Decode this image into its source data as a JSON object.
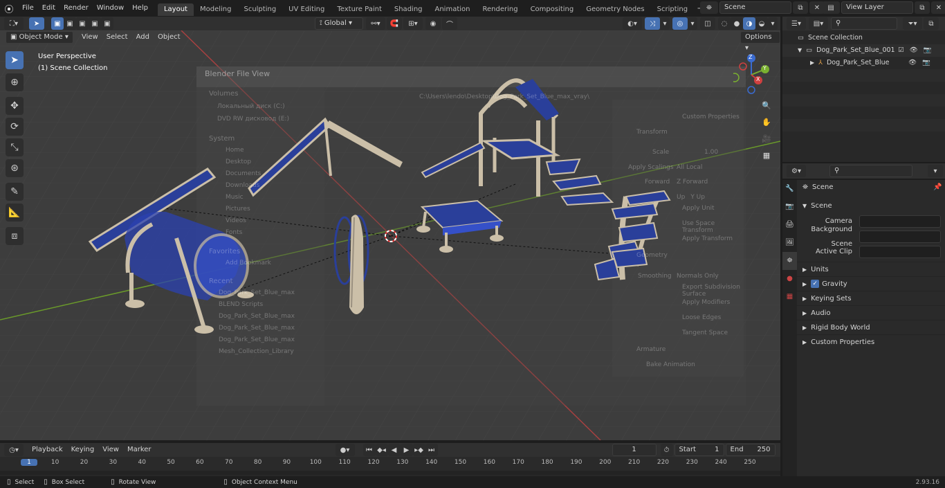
{
  "top_menu": [
    "File",
    "Edit",
    "Render",
    "Window",
    "Help"
  ],
  "workspace_tabs": [
    "Layout",
    "Modeling",
    "Sculpting",
    "UV Editing",
    "Texture Paint",
    "Shading",
    "Animation",
    "Rendering",
    "Compositing",
    "Geometry Nodes",
    "Scripting"
  ],
  "active_tab": "Layout",
  "scene_name": "Scene",
  "view_layer": "View Layer",
  "viewport_header": {
    "mode": "Object Mode",
    "menus": [
      "View",
      "Select",
      "Add",
      "Object"
    ],
    "orientation": "Global",
    "options": "Options"
  },
  "viewport": {
    "perspective": "User Perspective",
    "collection": "(1) Scene Collection",
    "gizmo_axes": [
      "Z",
      "Y",
      "X"
    ]
  },
  "file_view": {
    "title": "Blender File View",
    "path": "C:\\Users\\lendo\\Desktop\\Dog_Park_Set_Blue_max_vray\\",
    "sections": [
      "Volumes",
      "System",
      "Favorites",
      "Recent"
    ],
    "volumes": [
      "Локальный диск (C:)",
      "DVD RW дисковод (E:)"
    ],
    "system": [
      "Home",
      "Desktop",
      "Documents",
      "Downloads",
      "Music",
      "Pictures",
      "Videos",
      "Fonts"
    ],
    "favorites": [
      "Add Bookmark"
    ],
    "recent": [
      "Dog_Park_Set_Blue_max",
      "BLEND Scripts",
      "Dog_Park_Set_Blue_max",
      "Dog_Park_Set_Blue_max",
      "Dog_Park_Set_Blue_max",
      "Mesh_Collection_Library"
    ],
    "export_settings": {
      "custom_properties": "Custom Properties",
      "transform_section": "Transform",
      "scale_label": "Scale",
      "scale_value": "1.00",
      "apply_scalings_label": "Apply Scalings",
      "apply_scalings_value": "All Local",
      "forward_label": "Forward",
      "forward_value": "Z Forward",
      "up_label": "Up",
      "up_value": "Y Up",
      "apply_unit": "Apply Unit",
      "use_space_transform": "Use Space Transform",
      "apply_transform": "Apply Transform",
      "geometry_section": "Geometry",
      "smoothing_label": "Smoothing",
      "smoothing_value": "Normals Only",
      "export_subdivision": "Export Subdivision Surface",
      "apply_modifiers": "Apply Modifiers",
      "loose_edges": "Loose Edges",
      "tangent_space": "Tangent Space",
      "armature_section": "Armature",
      "bake_animation": "Bake Animation"
    }
  },
  "outliner": {
    "root": "Scene Collection",
    "items": [
      {
        "label": "Dog_Park_Set_Blue_001",
        "level": 1
      },
      {
        "label": "Dog_Park_Set_Blue",
        "level": 2
      }
    ]
  },
  "properties": {
    "header": "Scene",
    "section": "Scene",
    "fields": [
      {
        "label": "Camera",
        "value": ""
      },
      {
        "label": "Background Scene",
        "value": ""
      },
      {
        "label": "Active Clip",
        "value": ""
      }
    ],
    "panels": [
      "Units",
      "Gravity",
      "Keying Sets",
      "Audio",
      "Rigid Body World",
      "Custom Properties"
    ],
    "gravity_checked": true
  },
  "timeline": {
    "menus": [
      "Playback",
      "Keying",
      "View",
      "Marker"
    ],
    "current_frame": "1",
    "start_label": "Start",
    "start": "1",
    "end_label": "End",
    "end": "250",
    "ticks": [
      "1",
      "10",
      "20",
      "30",
      "40",
      "50",
      "60",
      "70",
      "80",
      "90",
      "100",
      "110",
      "120",
      "130",
      "140",
      "150",
      "160",
      "170",
      "180",
      "190",
      "200",
      "210",
      "220",
      "230",
      "240",
      "250"
    ]
  },
  "statusbar": {
    "items": [
      "Select",
      "Box Select",
      "Rotate View",
      "Object Context Menu"
    ],
    "version": "2.93.16"
  },
  "colors": {
    "accent": "#4772b3",
    "equipment_blue": "#2a3f9a",
    "equipment_frame": "#cbbfa8",
    "grid_bg": "#3d3d3d",
    "x_axis": "#a84040",
    "y_axis": "#6a9a2a"
  }
}
